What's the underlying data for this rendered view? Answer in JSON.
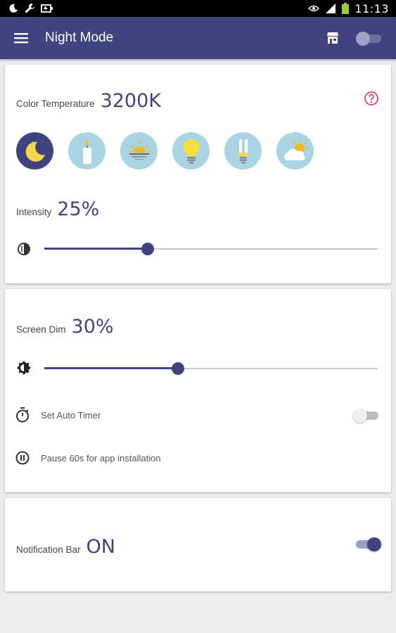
{
  "status_bar": {
    "time": "11:13"
  },
  "app_bar": {
    "title": "Night Mode",
    "enabled": false
  },
  "color_card": {
    "label": "Color Temperature",
    "value": "3200K",
    "presets": [
      {
        "name": "moon",
        "selected": true
      },
      {
        "name": "candle",
        "selected": false
      },
      {
        "name": "sunset",
        "selected": false
      },
      {
        "name": "bulb",
        "selected": false
      },
      {
        "name": "fluorescent",
        "selected": false
      },
      {
        "name": "cloudy-sun",
        "selected": false
      }
    ],
    "intensity_label": "Intensity",
    "intensity_value": "25%",
    "intensity_level": 0.31
  },
  "dim_card": {
    "label": "Screen Dim",
    "value": "30%",
    "dim_level": 0.4,
    "auto_timer_label": "Set Auto Timer",
    "auto_timer_on": false,
    "pause_label": "Pause 60s for app installation"
  },
  "notification_card": {
    "label": "Notification Bar",
    "value": "ON",
    "enabled": true
  },
  "colors": {
    "primary": "#3f4480",
    "preset_bg": "#a8d4e4",
    "help_icon": "#e0407a"
  }
}
